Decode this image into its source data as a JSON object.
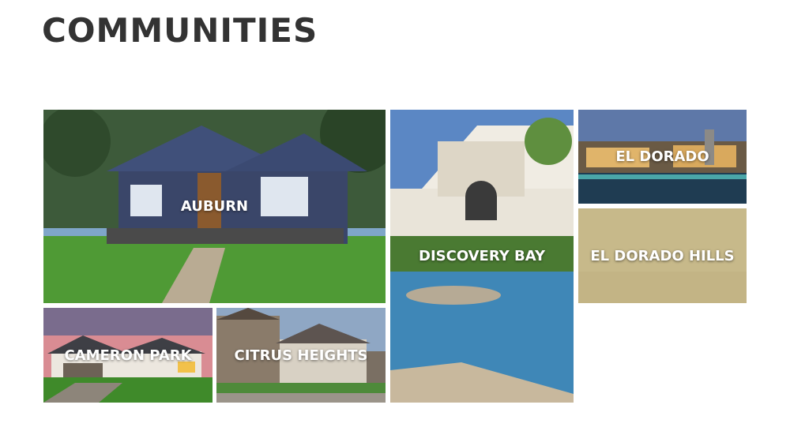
{
  "page": {
    "title": "COMMUNITIES"
  },
  "communities": [
    {
      "label": "AUBURN"
    },
    {
      "label": "DISCOVERY BAY"
    },
    {
      "label": "EL DORADO"
    },
    {
      "label": "EL DORADO HILLS"
    },
    {
      "label": "CAMERON PARK"
    },
    {
      "label": "CITRUS HEIGHTS"
    }
  ],
  "colors": {
    "title_text": "#333333",
    "label_text": "#ffffff",
    "placeholder_tile": "#c7b98a"
  }
}
